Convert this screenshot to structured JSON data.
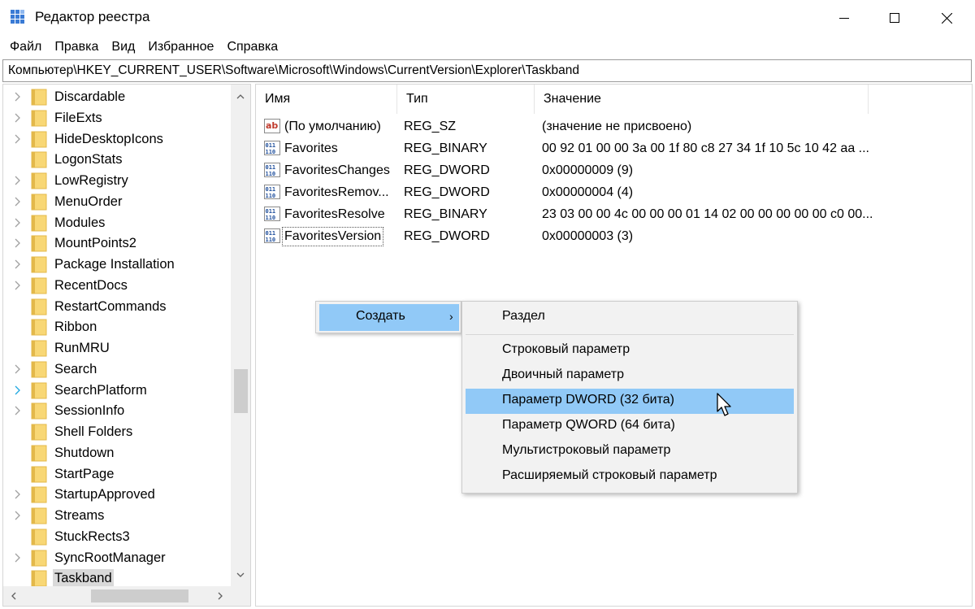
{
  "window": {
    "title": "Редактор реестра"
  },
  "menubar": [
    "Файл",
    "Правка",
    "Вид",
    "Избранное",
    "Справка"
  ],
  "address": "Компьютер\\HKEY_CURRENT_USER\\Software\\Microsoft\\Windows\\CurrentVersion\\Explorer\\Taskband",
  "tree": {
    "items": [
      {
        "label": "Discardable",
        "expander": "collapsed"
      },
      {
        "label": "FileExts",
        "expander": "collapsed"
      },
      {
        "label": "HideDesktopIcons",
        "expander": "collapsed"
      },
      {
        "label": "LogonStats",
        "expander": "none"
      },
      {
        "label": "LowRegistry",
        "expander": "collapsed"
      },
      {
        "label": "MenuOrder",
        "expander": "collapsed"
      },
      {
        "label": "Modules",
        "expander": "collapsed"
      },
      {
        "label": "MountPoints2",
        "expander": "collapsed"
      },
      {
        "label": "Package Installation",
        "expander": "collapsed"
      },
      {
        "label": "RecentDocs",
        "expander": "collapsed"
      },
      {
        "label": "RestartCommands",
        "expander": "none"
      },
      {
        "label": "Ribbon",
        "expander": "none"
      },
      {
        "label": "RunMRU",
        "expander": "none"
      },
      {
        "label": "Search",
        "expander": "collapsed"
      },
      {
        "label": "SearchPlatform",
        "expander": "hover"
      },
      {
        "label": "SessionInfo",
        "expander": "collapsed"
      },
      {
        "label": "Shell Folders",
        "expander": "none"
      },
      {
        "label": "Shutdown",
        "expander": "none"
      },
      {
        "label": "StartPage",
        "expander": "none"
      },
      {
        "label": "StartupApproved",
        "expander": "collapsed"
      },
      {
        "label": "Streams",
        "expander": "collapsed"
      },
      {
        "label": "StuckRects3",
        "expander": "none"
      },
      {
        "label": "SyncRootManager",
        "expander": "collapsed"
      },
      {
        "label": "Taskband",
        "expander": "none",
        "selected": true
      }
    ]
  },
  "values": {
    "headers": {
      "name": "Имя",
      "type": "Тип",
      "value": "Значение"
    },
    "rows": [
      {
        "icon": "string-value-icon",
        "name": "(По умолчанию)",
        "type": "REG_SZ",
        "data": "(значение не присвоено)"
      },
      {
        "icon": "binary-value-icon",
        "name": "Favorites",
        "type": "REG_BINARY",
        "data": "00 92 01 00 00 3a 00 1f 80 c8 27 34 1f 10 5c 10 42 aa ..."
      },
      {
        "icon": "binary-value-icon",
        "name": "FavoritesChanges",
        "type": "REG_DWORD",
        "data": "0x00000009 (9)"
      },
      {
        "icon": "binary-value-icon",
        "name": "FavoritesRemov...",
        "type": "REG_DWORD",
        "data": "0x00000004 (4)"
      },
      {
        "icon": "binary-value-icon",
        "name": "FavoritesResolve",
        "type": "REG_BINARY",
        "data": "23 03 00 00 4c 00 00 00 01 14 02 00 00 00 00 00 c0 00..."
      },
      {
        "icon": "binary-value-icon",
        "name": "FavoritesVersion",
        "type": "REG_DWORD",
        "data": "0x00000003 (3)",
        "focused": true
      }
    ]
  },
  "context_menu": {
    "create_label": "Создать",
    "submenu_arrow": "›",
    "submenu": [
      "Раздел",
      "Строковый параметр",
      "Двоичный параметр",
      "Параметр DWORD (32 бита)",
      "Параметр QWORD (64 бита)",
      "Мультистроковый параметр",
      "Расширяемый строковый параметр"
    ],
    "highlighted_index": 3
  },
  "colors": {
    "highlight": "#91c9f7",
    "menu_bg": "#f2f2f2",
    "folder": "#f8d775",
    "folder_dark": "#e3b84a"
  }
}
